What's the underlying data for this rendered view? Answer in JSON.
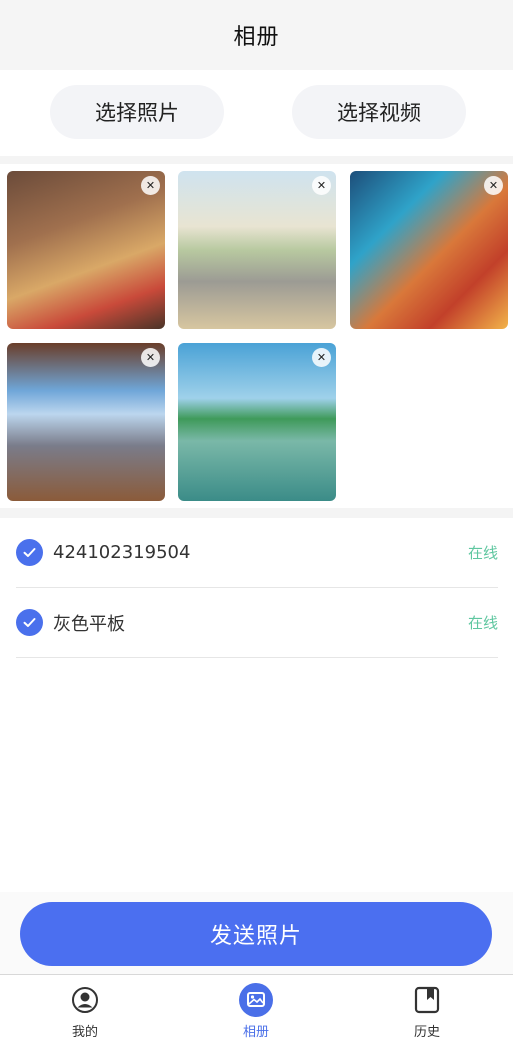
{
  "header": {
    "title": "相册"
  },
  "actions": {
    "select_photo": "选择照片",
    "select_video": "选择视频"
  },
  "photos": [
    {
      "name": "teddy-bears-photo",
      "delete_icon": "close-icon"
    },
    {
      "name": "beach-pool-photo",
      "delete_icon": "close-icon"
    },
    {
      "name": "colorful-cubes-photo",
      "delete_icon": "close-icon"
    },
    {
      "name": "anime-window-painting-photo",
      "delete_icon": "close-icon"
    },
    {
      "name": "underwater-palm-photo",
      "delete_icon": "close-icon"
    }
  ],
  "devices": [
    {
      "name": "424102319504",
      "status": "在线",
      "checked": true
    },
    {
      "name": "灰色平板",
      "status": "在线",
      "checked": true
    }
  ],
  "send": {
    "label": "发送照片"
  },
  "tabs": [
    {
      "label": "我的",
      "icon": "user-icon"
    },
    {
      "label": "相册",
      "icon": "album-icon",
      "active": true
    },
    {
      "label": "历史",
      "icon": "bookmark-icon"
    }
  ],
  "colors": {
    "accent": "#4b6ff0",
    "online": "#5fc7a0"
  }
}
